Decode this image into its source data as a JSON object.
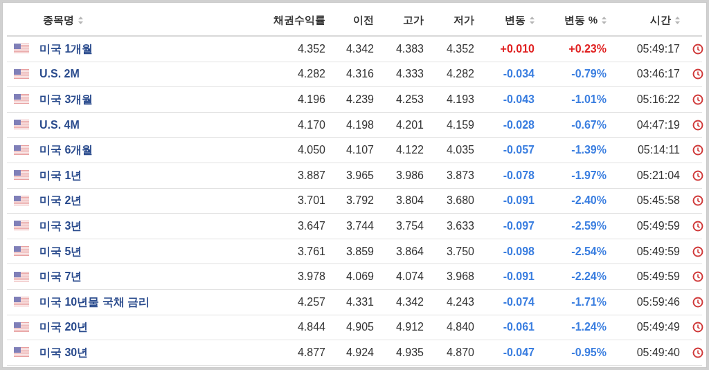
{
  "columns": [
    {
      "label": "종목명",
      "sortable": true
    },
    {
      "label": "채권수익률",
      "sortable": false
    },
    {
      "label": "이전",
      "sortable": false
    },
    {
      "label": "고가",
      "sortable": false
    },
    {
      "label": "저가",
      "sortable": false
    },
    {
      "label": "변동",
      "sortable": true
    },
    {
      "label": "변동 %",
      "sortable": true
    },
    {
      "label": "시간",
      "sortable": true
    }
  ],
  "rows": [
    {
      "name": "미국 1개월",
      "yield": "4.352",
      "prev": "4.342",
      "high": "4.383",
      "low": "4.352",
      "change": "+0.010",
      "change_pct": "+0.23%",
      "color": "#e02020",
      "time": "05:49:17"
    },
    {
      "name": "U.S. 2M",
      "yield": "4.282",
      "prev": "4.316",
      "high": "4.333",
      "low": "4.282",
      "change": "-0.034",
      "change_pct": "-0.79%",
      "color": "#3a7ee0",
      "time": "03:46:17"
    },
    {
      "name": "미국 3개월",
      "yield": "4.196",
      "prev": "4.239",
      "high": "4.253",
      "low": "4.193",
      "change": "-0.043",
      "change_pct": "-1.01%",
      "color": "#3a7ee0",
      "time": "05:16:22"
    },
    {
      "name": "U.S. 4M",
      "yield": "4.170",
      "prev": "4.198",
      "high": "4.201",
      "low": "4.159",
      "change": "-0.028",
      "change_pct": "-0.67%",
      "color": "#3a7ee0",
      "time": "04:47:19"
    },
    {
      "name": "미국 6개월",
      "yield": "4.050",
      "prev": "4.107",
      "high": "4.122",
      "low": "4.035",
      "change": "-0.057",
      "change_pct": "-1.39%",
      "color": "#3a7ee0",
      "time": "05:14:11"
    },
    {
      "name": "미국 1년",
      "yield": "3.887",
      "prev": "3.965",
      "high": "3.986",
      "low": "3.873",
      "change": "-0.078",
      "change_pct": "-1.97%",
      "color": "#3a7ee0",
      "time": "05:21:04"
    },
    {
      "name": "미국 2년",
      "yield": "3.701",
      "prev": "3.792",
      "high": "3.804",
      "low": "3.680",
      "change": "-0.091",
      "change_pct": "-2.40%",
      "color": "#3a7ee0",
      "time": "05:45:58"
    },
    {
      "name": "미국 3년",
      "yield": "3.647",
      "prev": "3.744",
      "high": "3.754",
      "low": "3.633",
      "change": "-0.097",
      "change_pct": "-2.59%",
      "color": "#3a7ee0",
      "time": "05:49:59"
    },
    {
      "name": "미국 5년",
      "yield": "3.761",
      "prev": "3.859",
      "high": "3.864",
      "low": "3.750",
      "change": "-0.098",
      "change_pct": "-2.54%",
      "color": "#3a7ee0",
      "time": "05:49:59"
    },
    {
      "name": "미국 7년",
      "yield": "3.978",
      "prev": "4.069",
      "high": "4.074",
      "low": "3.968",
      "change": "-0.091",
      "change_pct": "-2.24%",
      "color": "#3a7ee0",
      "time": "05:49:59"
    },
    {
      "name": "미국 10년물 국채 금리",
      "yield": "4.257",
      "prev": "4.331",
      "high": "4.342",
      "low": "4.243",
      "change": "-0.074",
      "change_pct": "-1.71%",
      "color": "#3a7ee0",
      "time": "05:59:46"
    },
    {
      "name": "미국 20년",
      "yield": "4.844",
      "prev": "4.905",
      "high": "4.912",
      "low": "4.840",
      "change": "-0.061",
      "change_pct": "-1.24%",
      "color": "#3a7ee0",
      "time": "05:49:49"
    },
    {
      "name": "미국 30년",
      "yield": "4.877",
      "prev": "4.924",
      "high": "4.935",
      "low": "4.870",
      "change": "-0.047",
      "change_pct": "-0.95%",
      "color": "#3a7ee0",
      "time": "05:49:40"
    }
  ]
}
